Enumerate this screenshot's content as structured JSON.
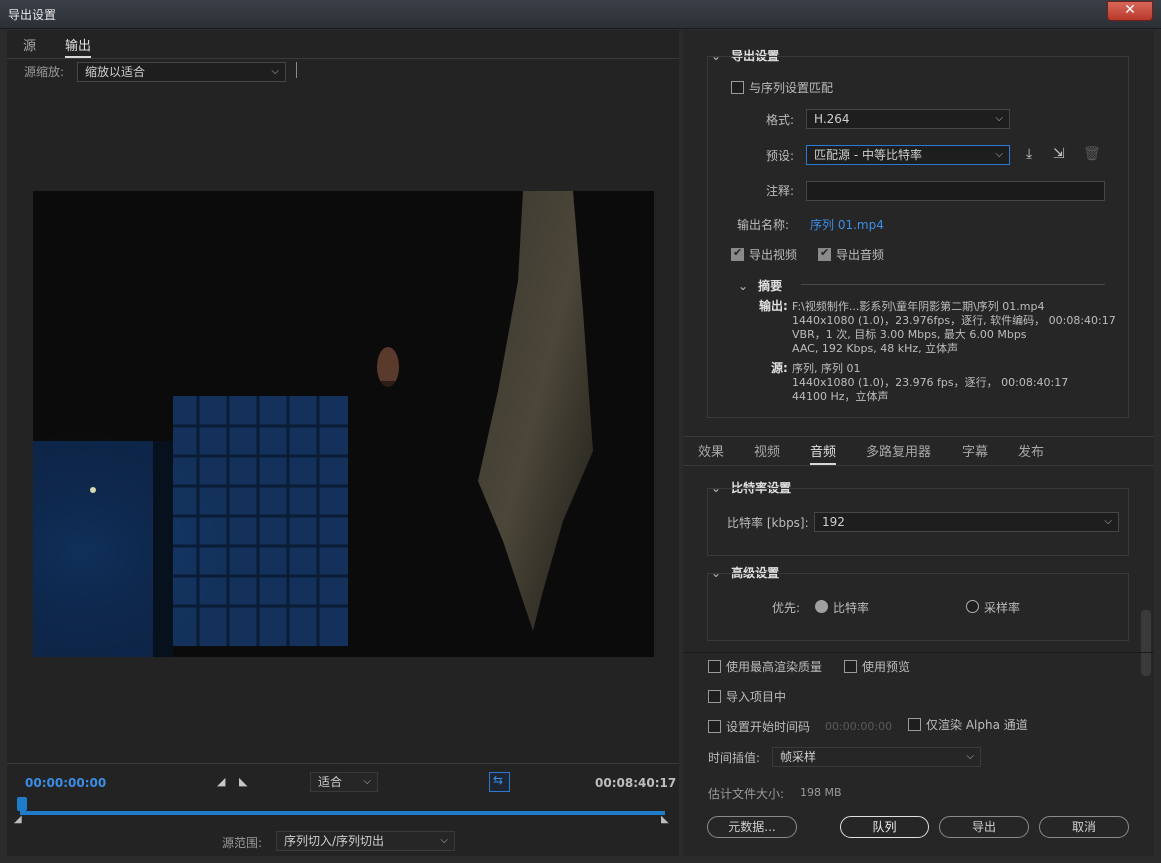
{
  "window": {
    "title": "导出设置",
    "close_icon": "✕"
  },
  "left": {
    "tabs": [
      "源",
      "输出"
    ],
    "active_tab": "输出",
    "source_scale_label": "源缩放:",
    "source_scale_value": "缩放以适合",
    "timecode_start": "00:00:00:00",
    "timecode_end": "00:08:40:17",
    "fit_value": "适合",
    "source_range_label": "源范围:",
    "source_range_value": "序列切入/序列切出"
  },
  "export_settings": {
    "heading": "导出设置",
    "match_sequence_label": "与序列设置匹配",
    "format_label": "格式:",
    "format_value": "H.264",
    "preset_label": "预设:",
    "preset_value": "匹配源 - 中等比特率",
    "comment_label": "注释:",
    "output_name_label": "输出名称:",
    "output_name_value": "序列 01.mp4",
    "export_video_label": "导出视频",
    "export_audio_label": "导出音频",
    "summary_heading": "摘要",
    "output_key": "输出:",
    "output_lines": [
      "F:\\视频制作...影系列\\童年阴影第二期\\序列 01.mp4",
      "1440x1080 (1.0)，23.976fps，逐行, 软件编码，  00:08:40:17",
      "VBR，1 次, 目标 3.00 Mbps, 最大 6.00 Mbps",
      "AAC, 192 Kbps, 48  kHz, 立体声"
    ],
    "source_key": "源:",
    "source_lines": [
      "序列, 序列 01",
      "1440x1080 (1.0)，23.976 fps，逐行，  00:08:40:17",
      "44100 Hz，立体声"
    ]
  },
  "settings_tabs": [
    "效果",
    "视频",
    "音频",
    "多路复用器",
    "字幕",
    "发布"
  ],
  "active_settings_tab": "音频",
  "bitrate": {
    "heading": "比特率设置",
    "label": "比特率 [kbps]:",
    "value": "192"
  },
  "advanced": {
    "heading": "高级设置",
    "priority_label": "优先:",
    "option_bitrate": "比特率",
    "option_sample_rate": "采样率"
  },
  "bottom": {
    "max_render_quality": "使用最高渲染质量",
    "use_previews": "使用预览",
    "import_into_project": "导入项目中",
    "set_start_timecode": "设置开始时间码",
    "start_timecode_value": "00:00:00:00",
    "render_alpha_only": "仅渲染 Alpha 通道",
    "time_interpolation_label": "时间插值:",
    "time_interpolation_value": "帧采样",
    "estimated_size_label": "估计文件大小:",
    "estimated_size_value": "198 MB"
  },
  "buttons": {
    "metadata": "元数据...",
    "queue": "队列",
    "export": "导出",
    "cancel": "取消"
  }
}
